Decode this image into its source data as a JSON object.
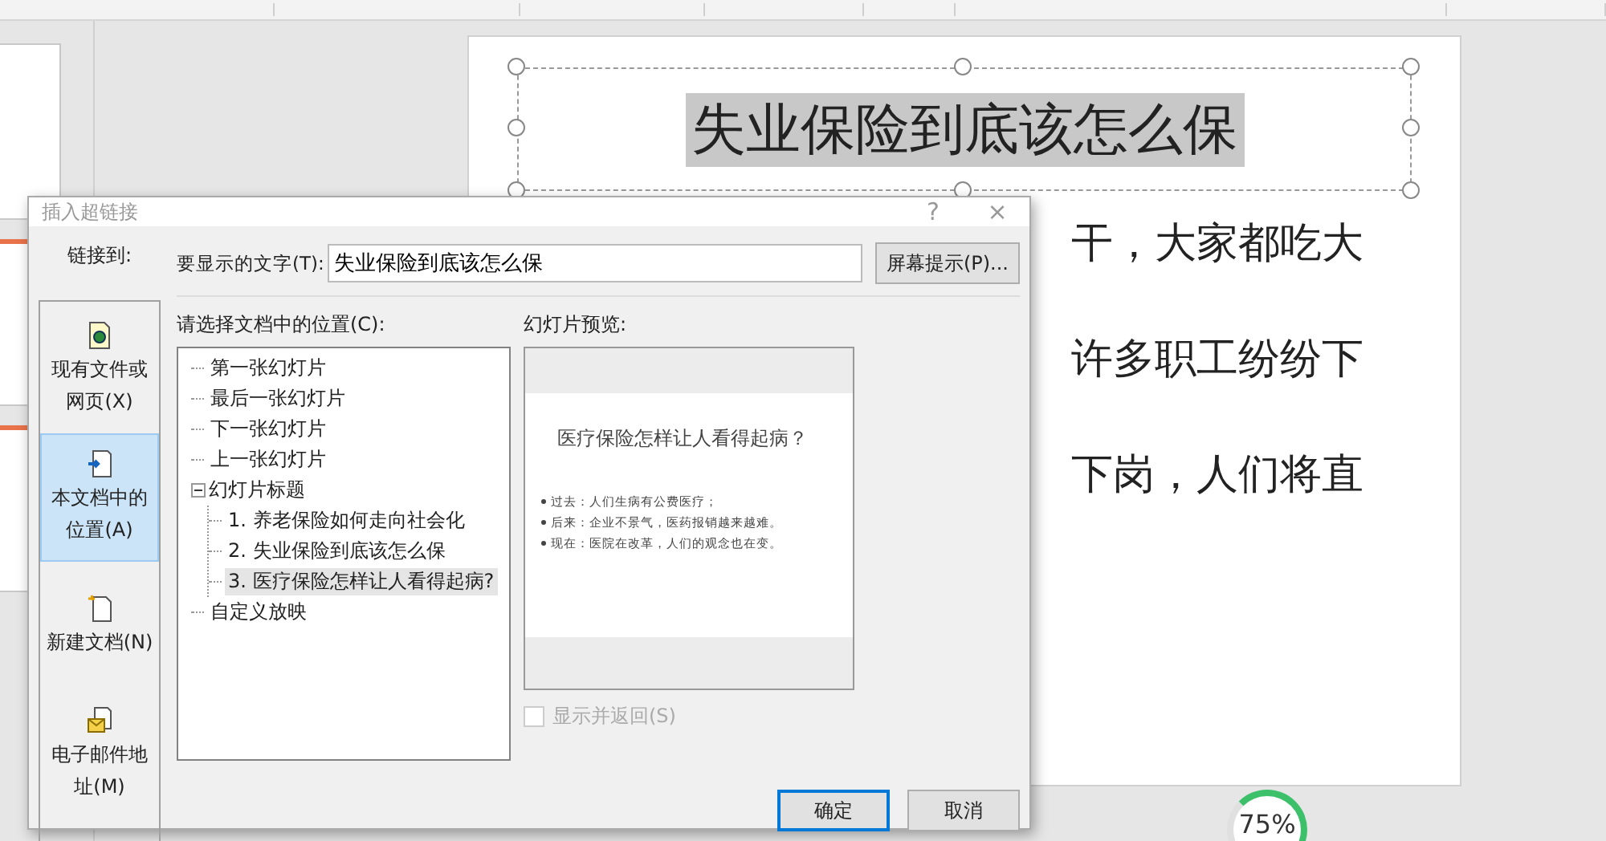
{
  "zoom_badge": {
    "text": "75%",
    "level": 0.75
  },
  "slide": {
    "title": "失业保险到底该怎么保",
    "title_selected": true,
    "body_lines": [
      "干，大家都吃大",
      "许多职工纷纷下",
      "下岗，人们将直"
    ]
  },
  "dialog": {
    "title": "插入超链接",
    "help": "?",
    "close": "×",
    "link_to_label": "链接到:",
    "link_targets": [
      {
        "kind": "file",
        "label": "现有文件或网页(X)",
        "selected": false
      },
      {
        "kind": "place",
        "label": "本文档中的位置(A)",
        "selected": true
      },
      {
        "kind": "new",
        "label": "新建文档(N)",
        "selected": false
      },
      {
        "kind": "email",
        "label": "电子邮件地址(M)",
        "selected": false
      }
    ],
    "display_text_label": "要显示的文字(T):",
    "display_text_value": "失业保险到底该怎么保",
    "screentip_button": "屏幕提示(P)...",
    "place_label": "请选择文档中的位置(C):",
    "places": [
      {
        "label": "第一张幻灯片",
        "selected": false
      },
      {
        "label": "最后一张幻灯片",
        "selected": false
      },
      {
        "label": "下一张幻灯片",
        "selected": false
      },
      {
        "label": "上一张幻灯片",
        "selected": false
      },
      {
        "label": "幻灯片标题",
        "selected": false,
        "expanded": true,
        "children": [
          {
            "label": "1. 养老保险如何走向社会化",
            "selected": false
          },
          {
            "label": "2. 失业保险到底该怎么保",
            "selected": false
          },
          {
            "label": "3. 医疗保险怎样让人看得起病?",
            "selected": true
          }
        ]
      },
      {
        "label": "自定义放映",
        "selected": false
      }
    ],
    "preview_label": "幻灯片预览:",
    "preview": {
      "title": "医疗保险怎样让人看得起病？",
      "bullets": [
        "过去：人们生病有公费医疗；",
        "后来：企业不景气，医药报销越来越难。",
        "现在：医院在改革，人们的观念也在变。"
      ]
    },
    "show_and_return": {
      "label": "显示并返回(S)",
      "checked": false,
      "disabled": true
    },
    "buttons": [
      {
        "kind": "default",
        "label": "确定"
      },
      {
        "kind": "normal",
        "label": "取消"
      }
    ]
  }
}
